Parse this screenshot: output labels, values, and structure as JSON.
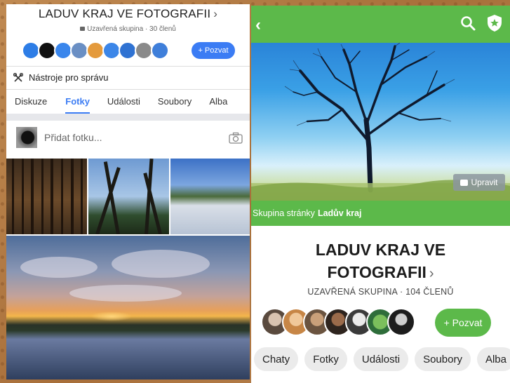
{
  "left_app": {
    "group_title": "LADUV KRAJ VE FOTOGRAFII",
    "title_chevron": "›",
    "group_meta": "Uzavřená skupina · 30 členů",
    "invite_label": "+ Pozvat",
    "admin_tools_label": "Nástroje pro správu",
    "tabs": [
      "Diskuze",
      "Fotky",
      "Události",
      "Soubory",
      "Alba"
    ],
    "active_tab": "Fotky",
    "add_photo_placeholder": "Přidat fotku...",
    "accent_color": "#3b7cf4"
  },
  "right_app": {
    "edit_cover_label": "Upravit",
    "group_of_page_prefix": "Skupina stránky",
    "group_of_page_name": "Ladův kraj",
    "group_title_line1": "LADUV KRAJ VE",
    "group_title_line2": "FOTOGRAFII",
    "title_chevron": "›",
    "group_meta": "UZAVŘENÁ SKUPINA · 104 ČLENŮ",
    "invite_label": "+ Pozvat",
    "tabs": [
      "Chaty",
      "Fotky",
      "Události",
      "Soubory",
      "Alba"
    ],
    "accent_color": "#5cb94a"
  }
}
